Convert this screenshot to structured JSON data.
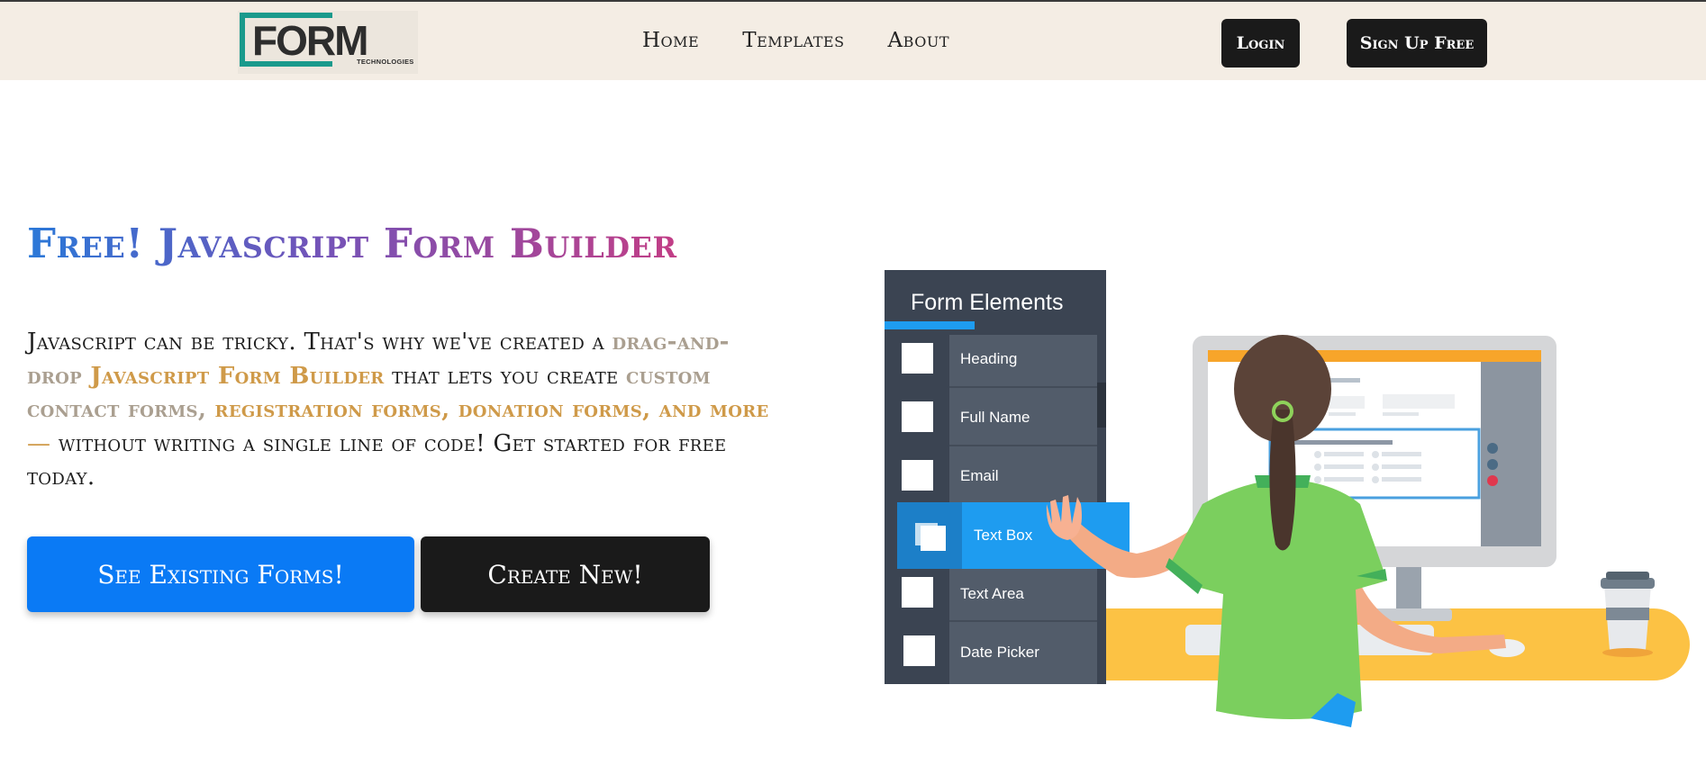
{
  "brand": {
    "logo_word": "FORM",
    "logo_sub": "TECHNOLOGIES",
    "teal": "#1a9a8c"
  },
  "nav": {
    "links": [
      "Home",
      "Templates",
      "About"
    ],
    "login_label": "Login",
    "signup_label": "Sign Up Free"
  },
  "hero": {
    "title": "Free! Javascript Form Builder",
    "desc": {
      "p1": "Javascript can be tricky. That's why we've created a ",
      "p2": "drag-and-drop",
      "p3": " Javascript Form Builder",
      "p4": " that lets you create ",
      "p5": "custom contact forms,",
      "p6": " registration forms, donation forms, and more",
      "p7": " —",
      "p8": " without writing a single line of code! Get started for free today."
    },
    "cta_primary": "See Existing Forms!",
    "cta_secondary": "Create New!"
  },
  "illustration": {
    "panel_title": "Form Elements",
    "items": [
      "Heading",
      "Full Name",
      "Email",
      "Text Box",
      "Text Area",
      "Date Picker"
    ],
    "dragged_item": "Text Box"
  },
  "colors": {
    "primary_blue": "#0a7af5",
    "dark": "#1a1a1a",
    "nav_bg": "#f4ede4",
    "desk": "#fcc244",
    "panel": "#525c6a"
  }
}
